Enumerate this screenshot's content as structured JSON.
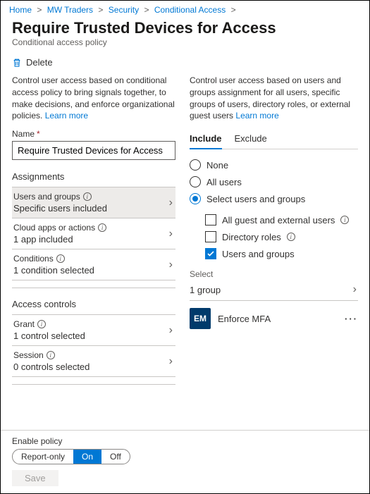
{
  "breadcrumb": {
    "items": [
      "Home",
      "MW Traders",
      "Security",
      "Conditional Access"
    ],
    "sep": ">"
  },
  "title": "Require Trusted Devices for Access",
  "subtitle": "Conditional access policy",
  "delete_label": "Delete",
  "left": {
    "desc": "Control user access based on conditional access policy to bring signals together, to make decisions, and enforce organizational policies.",
    "learn_more": "Learn more",
    "name_label": "Name",
    "name_value": "Require Trusted Devices for Access",
    "assignments_header": "Assignments",
    "items": {
      "users": {
        "label": "Users and groups",
        "value": "Specific users included"
      },
      "apps": {
        "label": "Cloud apps or actions",
        "value": "1 app included"
      },
      "conditions": {
        "label": "Conditions",
        "value": "1 condition selected"
      }
    },
    "access_header": "Access controls",
    "access": {
      "grant": {
        "label": "Grant",
        "value": "1 control selected"
      },
      "session": {
        "label": "Session",
        "value": "0 controls selected"
      }
    }
  },
  "right": {
    "desc": "Control user access based on users and groups assignment for all users, specific groups of users, directory roles, or external guest users",
    "learn_more": "Learn more",
    "tabs": {
      "include": "Include",
      "exclude": "Exclude"
    },
    "radios": {
      "none": "None",
      "all": "All users",
      "select": "Select users and groups"
    },
    "checks": {
      "guest": "All guest and external users",
      "dir": "Directory roles",
      "ug": "Users and groups"
    },
    "select_label": "Select",
    "select_value": "1 group",
    "group": {
      "initials": "EM",
      "name": "Enforce MFA"
    }
  },
  "footer": {
    "label": "Enable policy",
    "opts": {
      "report": "Report-only",
      "on": "On",
      "off": "Off"
    },
    "save": "Save"
  }
}
